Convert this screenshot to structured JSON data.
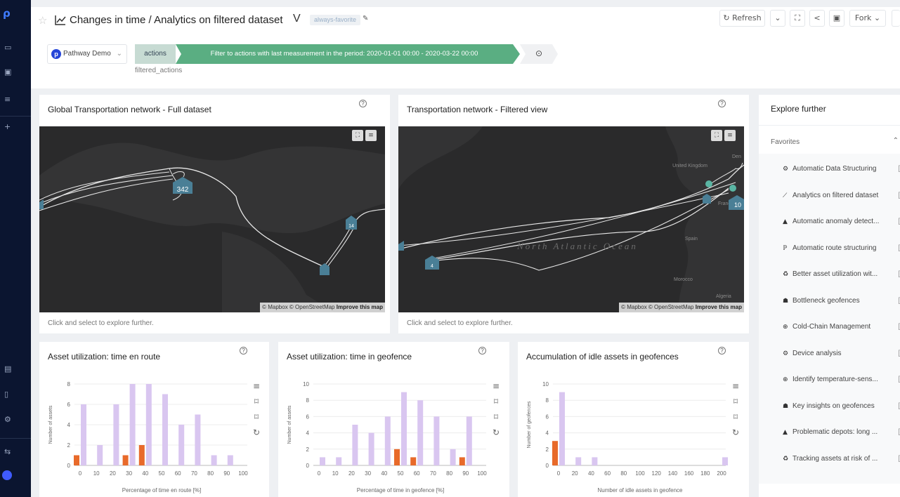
{
  "header": {
    "title": "Changes in time / Analytics on filtered dataset",
    "tag": "always-favorite",
    "toolbar": {
      "refresh": "Refresh",
      "fork": "Fork"
    }
  },
  "pipeline": {
    "datasource": "Pathway Demo",
    "step_actions": "actions",
    "step_filter": "Filter to actions with last measurement in the period: 2020-01-01 00:00 - 2020-03-22 00:00",
    "subtitle": "filtered_actions"
  },
  "maps": [
    {
      "title": "Global Transportation network - Full dataset",
      "footer": "Click and select to explore further.",
      "clusters": [
        "342",
        "14"
      ],
      "attribution": "© Mapbox © OpenStreetMap",
      "improve": "Improve this map"
    },
    {
      "title": "Transportation network - Filtered view",
      "footer": "Click and select to explore further.",
      "clusters": [
        "10",
        "4"
      ],
      "labels": [
        "United Kingdom",
        "France",
        "Spain",
        "Morocco",
        "Algeria",
        "Den",
        "North Atlantic Ocean"
      ],
      "attribution": "© Mapbox © OpenStreetMap",
      "improve": "Improve this map"
    }
  ],
  "chart_data": [
    {
      "type": "bar",
      "title": "Asset utilization: time en route",
      "xlabel": "Percentage of time en route [%]",
      "ylabel": "Number of assets",
      "x": [
        0,
        10,
        20,
        30,
        40,
        50,
        60,
        70,
        80,
        90,
        100
      ],
      "ylim": [
        0,
        8
      ],
      "yticks": [
        0,
        2,
        4,
        6,
        8
      ],
      "series": [
        {
          "color": "#d9c6f0",
          "values": [
            6,
            2,
            6,
            8,
            8,
            7,
            4,
            5,
            1,
            1,
            0
          ]
        },
        {
          "color": "#e86a2a",
          "values": [
            1,
            0,
            0,
            1,
            2,
            0,
            0,
            0,
            0,
            0,
            0
          ]
        }
      ]
    },
    {
      "type": "bar",
      "title": "Asset utilization: time in geofence",
      "xlabel": "Percentage of time in geofence [%]",
      "ylabel": "Number of assets",
      "x": [
        0,
        10,
        20,
        30,
        40,
        50,
        60,
        70,
        80,
        90,
        100
      ],
      "ylim": [
        0,
        10
      ],
      "yticks": [
        0,
        2,
        4,
        6,
        8,
        10
      ],
      "series": [
        {
          "color": "#d9c6f0",
          "values": [
            1,
            1,
            5,
            4,
            6,
            9,
            8,
            6,
            2,
            6,
            0
          ]
        },
        {
          "color": "#e86a2a",
          "values": [
            0,
            0,
            0,
            0,
            0,
            2,
            1,
            0,
            0,
            1,
            0
          ]
        }
      ]
    },
    {
      "type": "bar",
      "title": "Accumulation of idle assets in geofences",
      "xlabel": "Number of idle assets in geofence",
      "ylabel": "Number of geofences",
      "x": [
        0,
        20,
        40,
        60,
        80,
        100,
        120,
        140,
        160,
        180,
        200
      ],
      "ylim": [
        0,
        10
      ],
      "yticks": [
        0,
        2,
        4,
        6,
        8,
        10
      ],
      "series": [
        {
          "color": "#d9c6f0",
          "values": [
            9,
            1,
            1,
            0,
            0,
            0,
            0,
            0,
            0,
            0,
            1
          ]
        },
        {
          "color": "#e86a2a",
          "values": [
            3,
            0,
            0,
            0,
            0,
            0,
            0,
            0,
            0,
            0,
            0
          ]
        }
      ]
    }
  ],
  "explore": {
    "title": "Explore further",
    "favorites_label": "Favorites",
    "items": [
      {
        "label": "Automatic Data Structuring",
        "icon": "gears-icon"
      },
      {
        "label": "Analytics on filtered dataset",
        "icon": "line-chart-icon"
      },
      {
        "label": "Automatic anomaly detect...",
        "icon": "warning-icon"
      },
      {
        "label": "Automatic route structuring",
        "icon": "route-icon"
      },
      {
        "label": "Better asset utilization wit...",
        "icon": "recycle-icon"
      },
      {
        "label": "Bottleneck geofences",
        "icon": "map-marker-icon"
      },
      {
        "label": "Cold-Chain Management",
        "icon": "thermometer-icon"
      },
      {
        "label": "Device analysis",
        "icon": "gears-icon"
      },
      {
        "label": "Identify temperature-sens...",
        "icon": "thermometer-icon"
      },
      {
        "label": "Key insights on geofences",
        "icon": "map-marker-icon"
      },
      {
        "label": "Problematic depots: long ...",
        "icon": "warning-icon"
      },
      {
        "label": "Tracking assets at risk of ...",
        "icon": "recycle-icon"
      }
    ]
  }
}
